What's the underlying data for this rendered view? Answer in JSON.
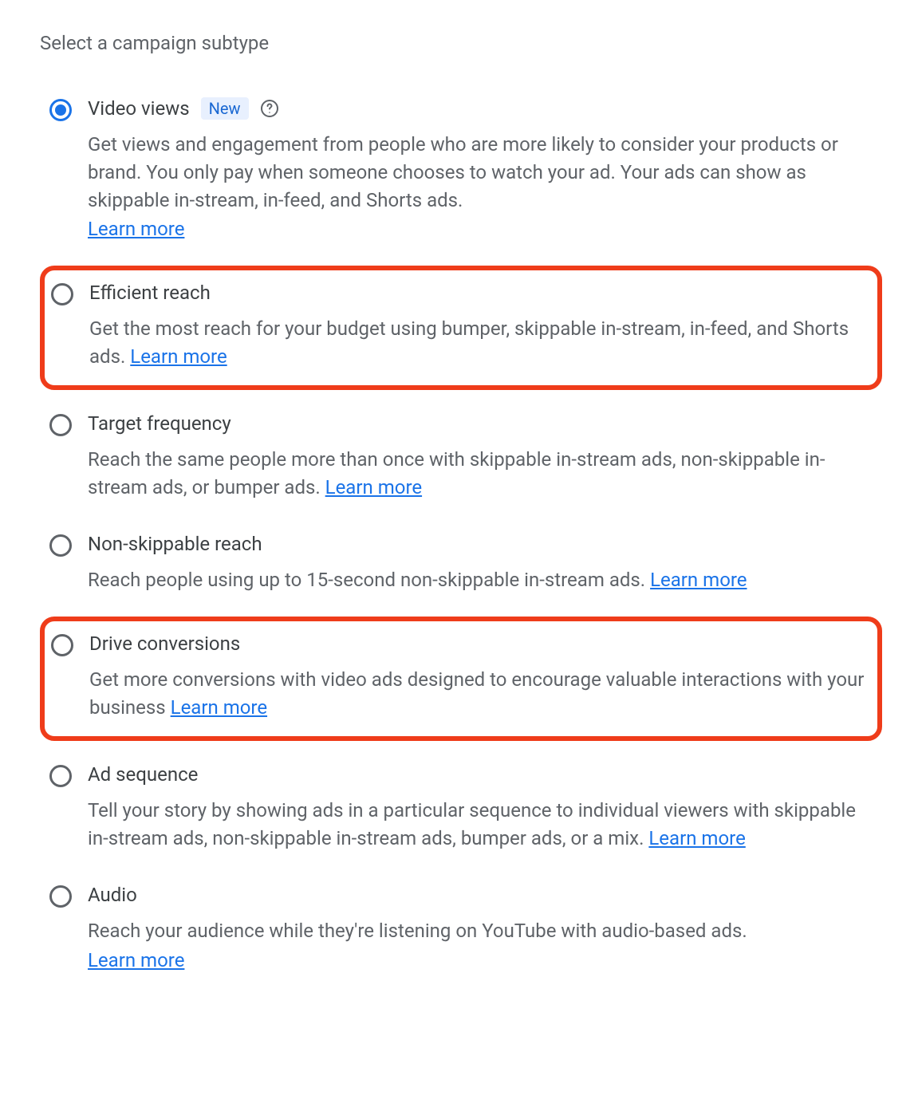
{
  "heading": "Select a campaign subtype",
  "new_badge_text": "New",
  "learn_more_text": "Learn more",
  "options": [
    {
      "id": "video-views",
      "title": "Video views",
      "selected": true,
      "has_new_badge": true,
      "has_help_icon": true,
      "highlighted": false,
      "description": "Get views and engagement from people who are more likely to consider your products or brand. You only pay when someone chooses to watch your ad. Your ads can show as skippable in-stream, in-feed, and Shorts ads.",
      "learn_more_inline": false
    },
    {
      "id": "efficient-reach",
      "title": "Efficient reach",
      "selected": false,
      "has_new_badge": false,
      "has_help_icon": false,
      "highlighted": true,
      "description": "Get the most reach for your budget using bumper, skippable in-stream, in-feed, and Shorts ads.",
      "learn_more_inline": true
    },
    {
      "id": "target-frequency",
      "title": "Target frequency",
      "selected": false,
      "has_new_badge": false,
      "has_help_icon": false,
      "highlighted": false,
      "description": "Reach the same people more than once with skippable in-stream ads, non-skippable in-stream ads, or bumper ads.",
      "learn_more_inline": true
    },
    {
      "id": "non-skippable-reach",
      "title": "Non-skippable reach",
      "selected": false,
      "has_new_badge": false,
      "has_help_icon": false,
      "highlighted": false,
      "description": "Reach people using up to 15-second non-skippable in-stream ads.",
      "learn_more_inline": true
    },
    {
      "id": "drive-conversions",
      "title": "Drive conversions",
      "selected": false,
      "has_new_badge": false,
      "has_help_icon": false,
      "highlighted": true,
      "description": "Get more conversions with video ads designed to encourage valuable interactions with your business",
      "learn_more_inline": true
    },
    {
      "id": "ad-sequence",
      "title": "Ad sequence",
      "selected": false,
      "has_new_badge": false,
      "has_help_icon": false,
      "highlighted": false,
      "description": "Tell your story by showing ads in a particular sequence to individual viewers with skippable in-stream ads, non-skippable in-stream ads, bumper ads, or a mix.",
      "learn_more_inline": true
    },
    {
      "id": "audio",
      "title": "Audio",
      "selected": false,
      "has_new_badge": false,
      "has_help_icon": false,
      "highlighted": false,
      "description": "Reach your audience while they're listening on YouTube with audio-based ads.",
      "learn_more_inline": false
    }
  ]
}
